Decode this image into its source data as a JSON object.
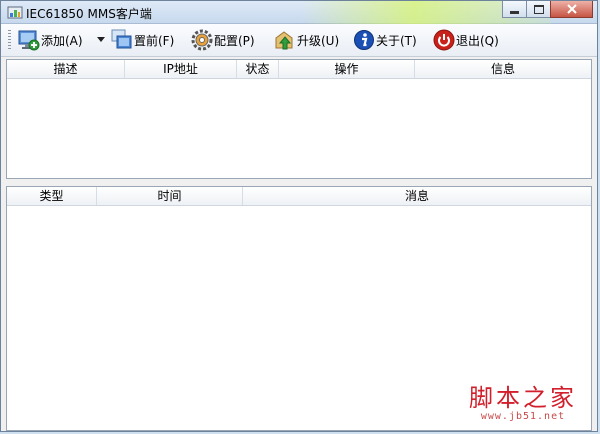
{
  "window": {
    "title": "IEC61850 MMS客户端"
  },
  "toolbar": {
    "add_label": "添加(A)",
    "front_label": "置前(F)",
    "config_label": "配置(P)",
    "upgrade_label": "升级(U)",
    "about_label": "关于(T)",
    "exit_label": "退出(Q)"
  },
  "device_table": {
    "columns": [
      "描述",
      "IP地址",
      "状态",
      "操作",
      "信息"
    ],
    "rows": []
  },
  "log_table": {
    "columns": [
      "类型",
      "时间",
      "消息"
    ],
    "rows": []
  },
  "watermark": {
    "text": "脚本之家",
    "url": "www.jb51.net"
  },
  "colors": {
    "exit_icon": "#c8201a",
    "about_icon": "#1a4fb4",
    "close_button": "#c65544",
    "watermark": "#d21f2b"
  }
}
